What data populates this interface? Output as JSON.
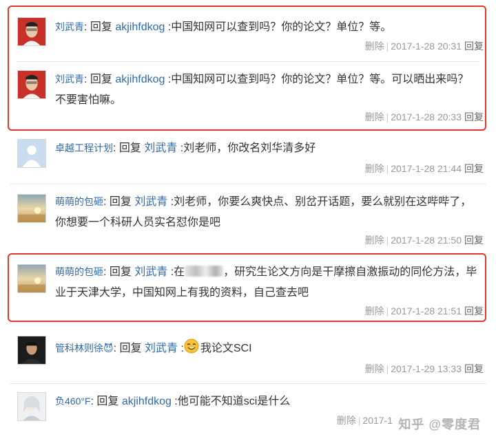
{
  "comments": [
    {
      "user": "刘武青",
      "reply_word": ": 回复 ",
      "target": "akjihfdkog",
      "text": " :中国知网可以查到吗？你的论文？单位？等。",
      "delete": "删除",
      "time": "2017-1-28 20:31",
      "reply": "回复"
    },
    {
      "user": "刘武青",
      "reply_word": ": 回复 ",
      "target": "akjihfdkog",
      "text": " :中国知网可以查到吗？你的论文？单位？等。可以晒出来吗？不要害怕嘛。",
      "delete": "删除",
      "time": "2017-1-28 20:33",
      "reply": "回复"
    },
    {
      "user": "卓越工程计划",
      "reply_word": ": 回复 ",
      "target": "刘武青",
      "text": " :刘老师，你改名刘华清多好",
      "delete": "删除",
      "time": "2017-1-28 21:44",
      "reply": "回复"
    },
    {
      "user": "萌萌的包砸",
      "reply_word": ": 回复 ",
      "target": "刘武青",
      "text": " :刘老师，你要么爽快点、别岔开话题，要么就别在这哔哔了，你想要一个科研人员实名怼你是吧",
      "delete": "删除",
      "time": "2017-1-28 21:50",
      "reply": "回复"
    },
    {
      "user": "萌萌的包砸",
      "reply_word": ": 回复 ",
      "target": "刘武青",
      "text_pre": " :在",
      "text": "，研究生论文方向是干摩擦自激振动的同伦方法，毕业于天津大学，中国知网上有我的资料，自己查去吧",
      "delete": "删除",
      "time": "2017-1-28 21:51",
      "reply": "回复"
    },
    {
      "user": "管科林则徐😈",
      "reply_word": ": 回复 ",
      "target": "刘武青",
      "text_pre": " :",
      "text": "我论文SCI",
      "emoji": "smiley-emoji",
      "delete": "删除",
      "time": "2017-1-29 13:33",
      "reply": "回复"
    },
    {
      "user": "负460°F",
      "reply_word": ": 回复 ",
      "target": "akjihfdkog",
      "text": " :他可能不知道sci是什么",
      "delete": "删除",
      "time": "2017-1",
      "reply": ""
    }
  ],
  "watermark": "知乎 @零度君",
  "highlight_color": "#e2362b",
  "link_color": "#2e6ab0"
}
